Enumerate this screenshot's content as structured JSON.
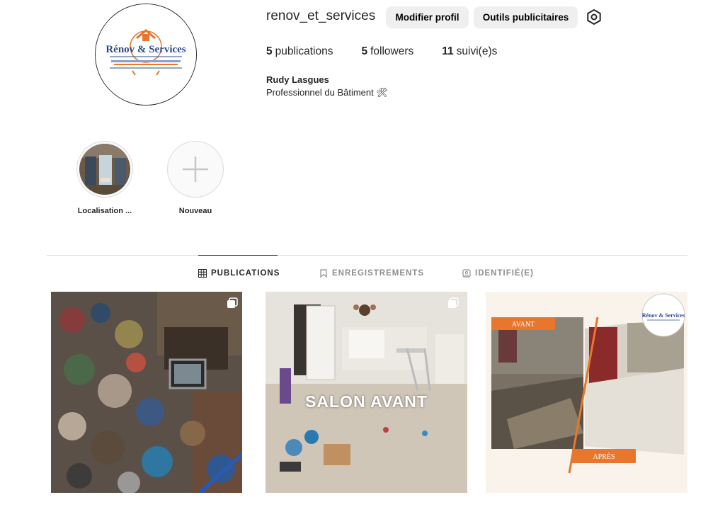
{
  "profile": {
    "username": "renov_et_services",
    "avatar_brand": "Rénov & Services",
    "edit_label": "Modifier profil",
    "ads_label": "Outils publicitaires",
    "settings_icon": "gear-icon",
    "stats": {
      "posts_count": "5",
      "posts_label": "publications",
      "followers_count": "5",
      "followers_label": "followers",
      "following_count": "11",
      "following_label": "suivi(e)s"
    },
    "full_name": "Rudy Lasgues",
    "bio": "Professionnel du Bâtiment 🛠"
  },
  "highlights": [
    {
      "label": "Localisation ..."
    },
    {
      "label": "Nouveau",
      "icon": "plus-icon"
    }
  ],
  "tabs": [
    {
      "label": "PUBLICATIONS",
      "icon": "grid-icon",
      "active": true
    },
    {
      "label": "ENREGISTREMENTS",
      "icon": "bookmark-icon",
      "active": false
    },
    {
      "label": "IDENTIFIÉ(E)",
      "icon": "tag-icon",
      "active": false
    }
  ],
  "posts": [
    {
      "overlay_text": "",
      "multi": true
    },
    {
      "overlay_text": "SALON AVANT",
      "multi": true
    },
    {
      "labels": [
        "AVANT",
        "APRÈS"
      ],
      "brand": "Rénov & Services",
      "multi": false
    }
  ],
  "colors": {
    "button_bg": "#efefef",
    "brand_blue": "#2b4a8b",
    "brand_orange": "#e8762c",
    "divider": "#dbdbdb",
    "muted": "#8e8e8e"
  }
}
